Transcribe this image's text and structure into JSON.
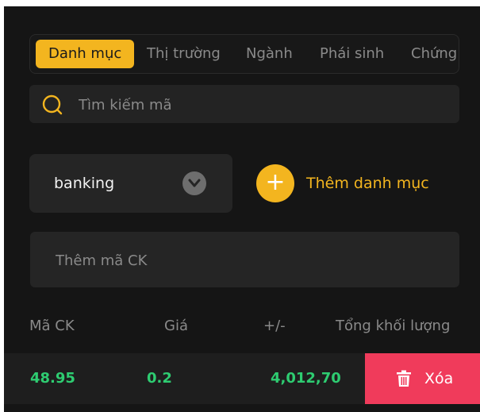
{
  "tabs": [
    {
      "label": "Danh mục",
      "active": true
    },
    {
      "label": "Thị trường",
      "active": false
    },
    {
      "label": "Ngành",
      "active": false
    },
    {
      "label": "Phái sinh",
      "active": false
    },
    {
      "label": "Chứng",
      "active": false
    }
  ],
  "search": {
    "placeholder": "Tìm kiếm mã",
    "icon": "search-icon"
  },
  "portfolio": {
    "selected": "banking",
    "icon": "chevron-down-icon"
  },
  "add_portfolio": {
    "label": "Thêm danh mục",
    "icon": "plus-icon"
  },
  "add_symbol": {
    "placeholder": "Thêm mã CK"
  },
  "table": {
    "headers": [
      "Mã CK",
      "Giá",
      "+/-",
      "Tổng khối lượng"
    ],
    "rows": [
      {
        "symbol": "48.95",
        "price": "0.2",
        "change": "4,012,70"
      }
    ],
    "delete_label": "Xóa"
  },
  "colors": {
    "accent": "#f3b51f",
    "background": "#151515",
    "positive": "#2ecc71",
    "danger": "#f03b5b"
  }
}
